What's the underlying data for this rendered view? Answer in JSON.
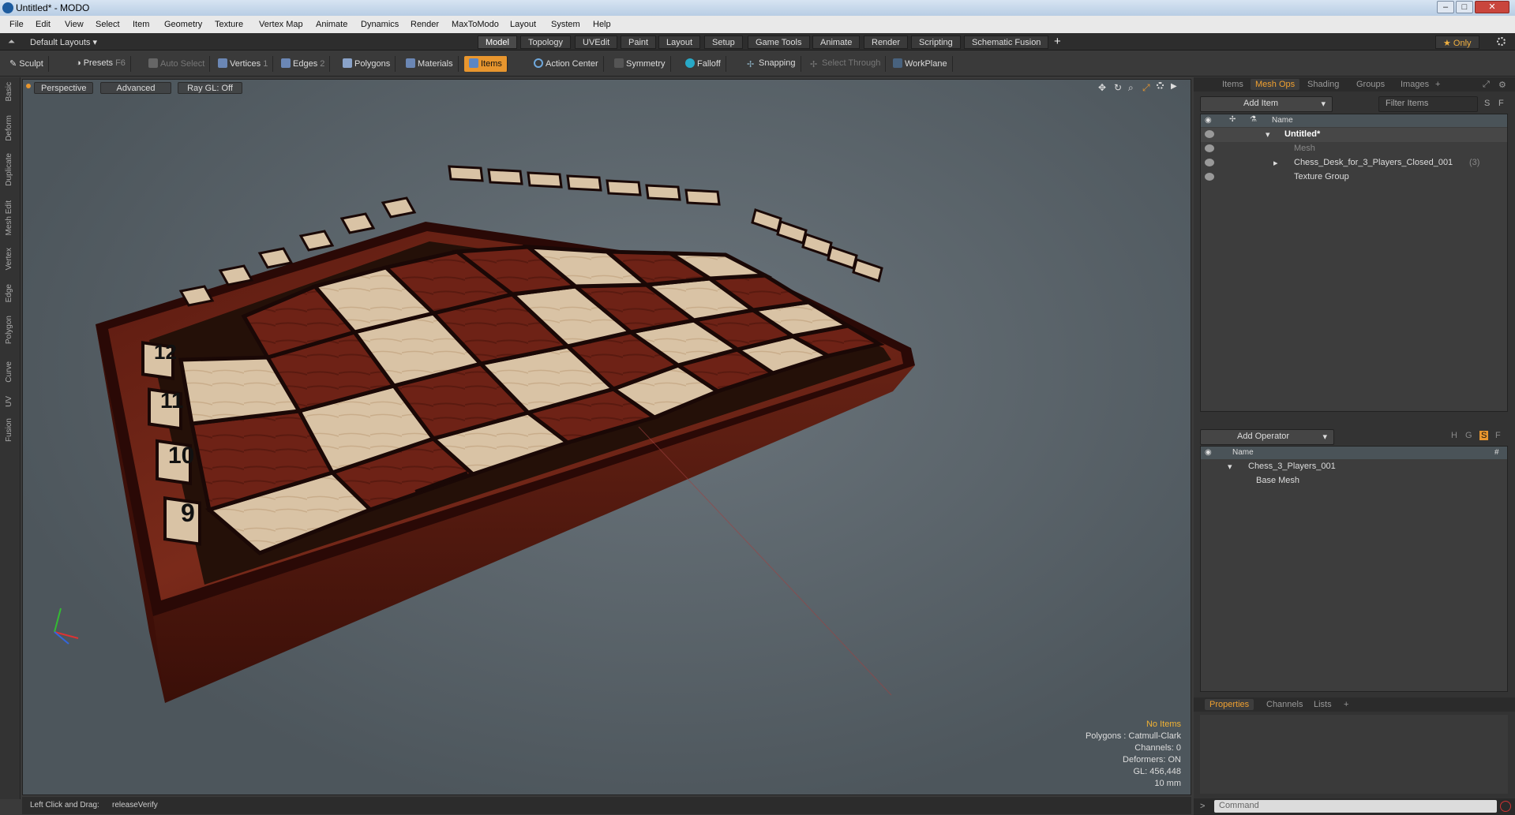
{
  "window": {
    "title": "Untitled* - MODO"
  },
  "menu": [
    "File",
    "Edit",
    "View",
    "Select",
    "Item",
    "Geometry",
    "Texture",
    "Vertex Map",
    "Animate",
    "Dynamics",
    "Render",
    "MaxToModo",
    "Layout",
    "System",
    "Help"
  ],
  "layouts": {
    "default_label": "Default Layouts",
    "tabs": [
      "Model",
      "Topology",
      "UVEdit",
      "Paint",
      "Layout",
      "Setup",
      "Game Tools",
      "Animate",
      "Render",
      "Scripting",
      "Schematic Fusion"
    ],
    "active": "Model",
    "only_label": "Only"
  },
  "toolbar": {
    "sculpt": "Sculpt",
    "presets": "Presets",
    "presets_key": "F6",
    "auto_select": "Auto Select",
    "vertices": "Vertices",
    "vertices_n": "1",
    "edges": "Edges",
    "edges_n": "2",
    "polygons": "Polygons",
    "materials": "Materials",
    "items": "Items",
    "action_center": "Action Center",
    "symmetry": "Symmetry",
    "falloff": "Falloff",
    "snapping": "Snapping",
    "select_through": "Select Through",
    "workplane": "WorkPlane"
  },
  "left_tabs": [
    "Basic",
    "Deform",
    "Duplicate",
    "Mesh Edit",
    "Vertex",
    "Edge",
    "Polygon",
    "Curve",
    "UV",
    "Fusion"
  ],
  "viewport": {
    "view": "Perspective",
    "advanced": "Advanced",
    "raygl": "Ray GL: Off",
    "stats": {
      "no_items": "No Items",
      "polygons": "Polygons : Catmull-Clark",
      "channels": "Channels: 0",
      "deformers": "Deformers: ON",
      "gl": "GL: 456,448",
      "size": "10 mm"
    },
    "board_numbers": [
      "12",
      "11",
      "10",
      "9"
    ]
  },
  "status": {
    "left": "Left Click and Drag:",
    "action": "releaseVerify"
  },
  "right_panel": {
    "tabs": [
      "Items",
      "Mesh Ops",
      "Shading",
      "Groups",
      "Images"
    ],
    "active_tab": "Mesh Ops",
    "add_item": "Add Item",
    "filter": "Filter Items",
    "name_col": "Name",
    "items": [
      {
        "name": "Untitled*"
      },
      {
        "name": "Mesh"
      },
      {
        "name": "Chess_Desk_for_3_Players_Closed_001",
        "count": "(3)"
      },
      {
        "name": "Texture Group"
      }
    ],
    "add_operator": "Add Operator",
    "op_name_col": "Name",
    "op_hash": "#",
    "operators": [
      {
        "name": "Chess_3_Players_001"
      },
      {
        "name": "Base Mesh"
      }
    ],
    "bottom_tabs": [
      "Properties",
      "Channels",
      "Lists"
    ],
    "bottom_active": "Properties",
    "command_placeholder": "Command"
  }
}
